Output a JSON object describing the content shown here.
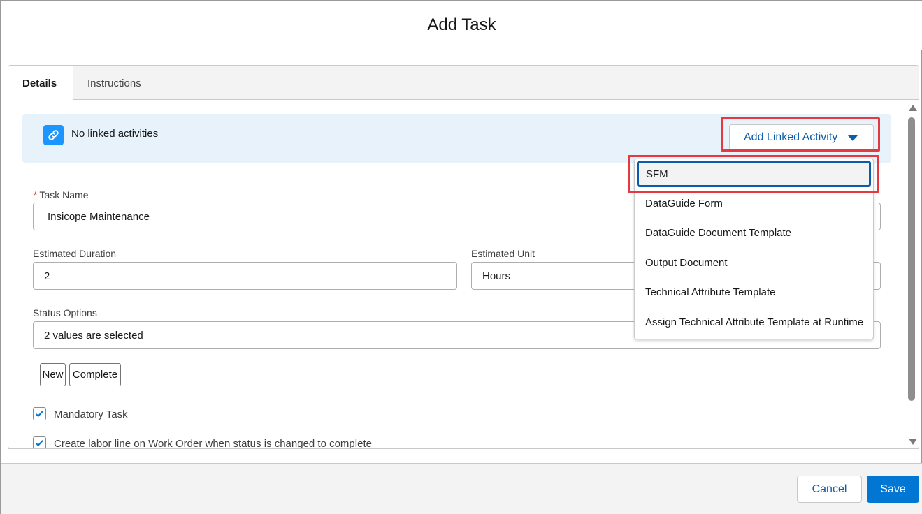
{
  "modal": {
    "title": "Add Task"
  },
  "tabs": [
    {
      "label": "Details",
      "active": true
    },
    {
      "label": "Instructions",
      "active": false
    }
  ],
  "banner": {
    "text": "No linked activities",
    "icon": "link-icon"
  },
  "add_linked_activity": {
    "label": "Add Linked Activity",
    "icon": "caret-down-icon"
  },
  "dropdown": {
    "items": [
      "SFM",
      "DataGuide Form",
      "DataGuide Document Template",
      "Output Document",
      "Technical Attribute Template",
      "Assign Technical Attribute Template at Runtime"
    ],
    "selected": "SFM"
  },
  "form": {
    "task_name": {
      "label": "Task Name",
      "required": "*",
      "value": "Insicope Maintenance"
    },
    "estimated_duration": {
      "label": "Estimated Duration",
      "value": "2"
    },
    "estimated_unit": {
      "label": "Estimated Unit",
      "value": "Hours"
    },
    "status_options": {
      "label": "Status Options",
      "value": "2 values are selected"
    },
    "status_buttons": [
      "New",
      "Complete"
    ],
    "mandatory_task": {
      "label": "Mandatory Task",
      "checked": true
    },
    "labor_line": {
      "label": "Create labor line on Work Order when status is changed to complete",
      "checked": true
    }
  },
  "footer": {
    "cancel_label": "Cancel",
    "save_label": "Save"
  },
  "colors": {
    "brand": "#0176d3",
    "link": "#0b5cab",
    "highlight": "#e5393f",
    "banner_bg": "#e8f2fa"
  }
}
